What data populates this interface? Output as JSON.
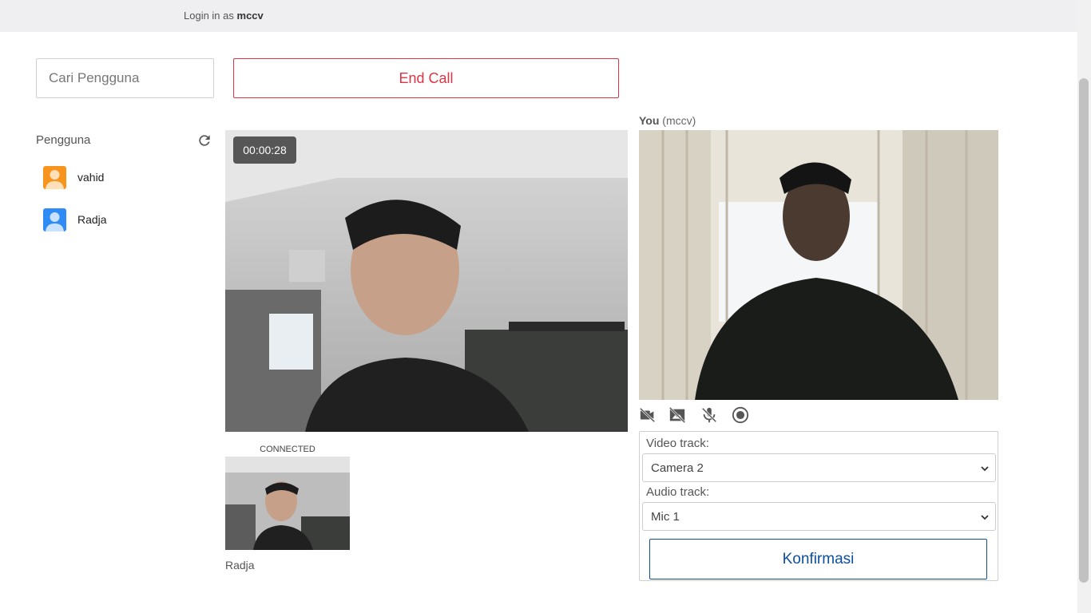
{
  "header": {
    "login_prefix": "Login in as",
    "username": "mccv"
  },
  "search": {
    "placeholder": "Cari Pengguna",
    "value": ""
  },
  "call": {
    "end_call_label": "End Call",
    "timer": "00:00:28",
    "status": "CONNECTED",
    "remote_name": "Radja"
  },
  "users": {
    "title": "Pengguna",
    "items": [
      {
        "name": "vahid",
        "color": "#f7941d"
      },
      {
        "name": "Radja",
        "color": "#2f8cf5"
      }
    ]
  },
  "local": {
    "you_label": "You",
    "you_suffix": "(mccv)"
  },
  "controls": {
    "icons": [
      "video-off-icon",
      "image-off-icon",
      "mic-off-icon",
      "record-icon"
    ]
  },
  "settings": {
    "video_label": "Video track:",
    "video_value": "Camera 2",
    "audio_label": "Audio track:",
    "audio_value": "Mic 1",
    "confirm_label": "Konfirmasi"
  },
  "colors": {
    "end_call": "#dc3545",
    "confirm": "#0d4f9e"
  }
}
